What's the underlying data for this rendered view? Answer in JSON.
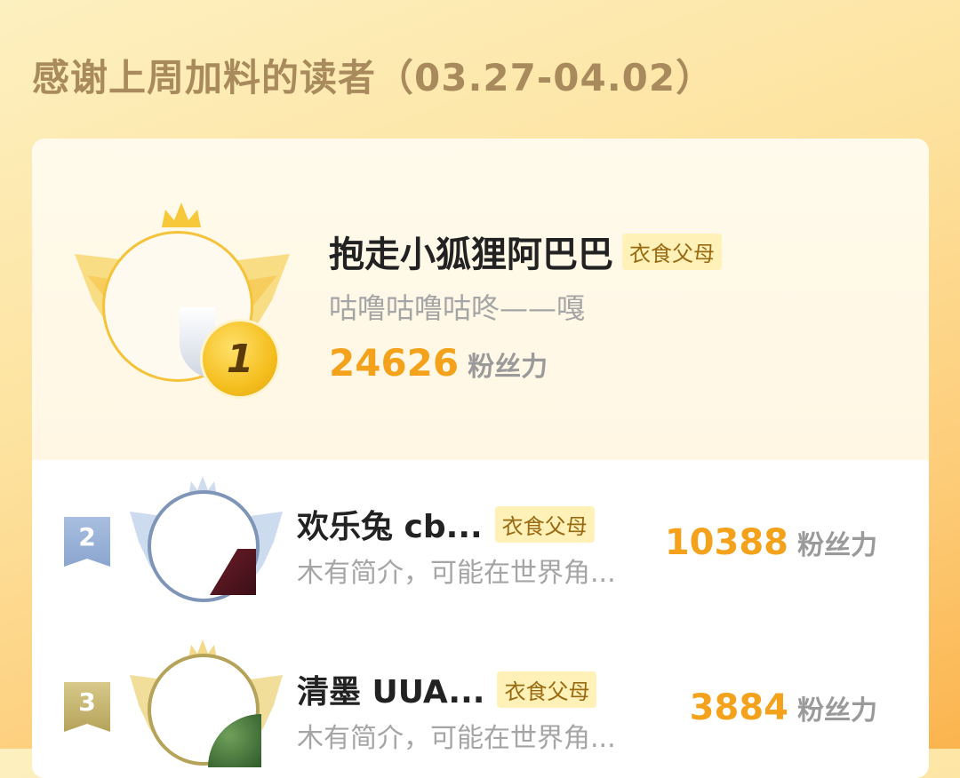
{
  "page": {
    "title": "感谢上周加料的读者（03.27-04.02）"
  },
  "tag_label": "衣食父母",
  "fans_label": "粉丝力",
  "colors": {
    "accent": "#f4a21c",
    "gold": "#f4c33a",
    "silver": "#7e95b8",
    "bronze": "#b5a35a"
  },
  "top": {
    "rank": "1",
    "name": "抱走小狐狸阿巴巴",
    "desc": "咕噜咕噜咕咚——嘎",
    "fans": "24626"
  },
  "list": [
    {
      "rank": "2",
      "name": "欢乐兔  cb...",
      "desc": "木有简介，可能在世界角...",
      "fans": "10388"
    },
    {
      "rank": "3",
      "name": "清墨  UUA...",
      "desc": "木有简介，可能在世界角...",
      "fans": "3884"
    }
  ]
}
